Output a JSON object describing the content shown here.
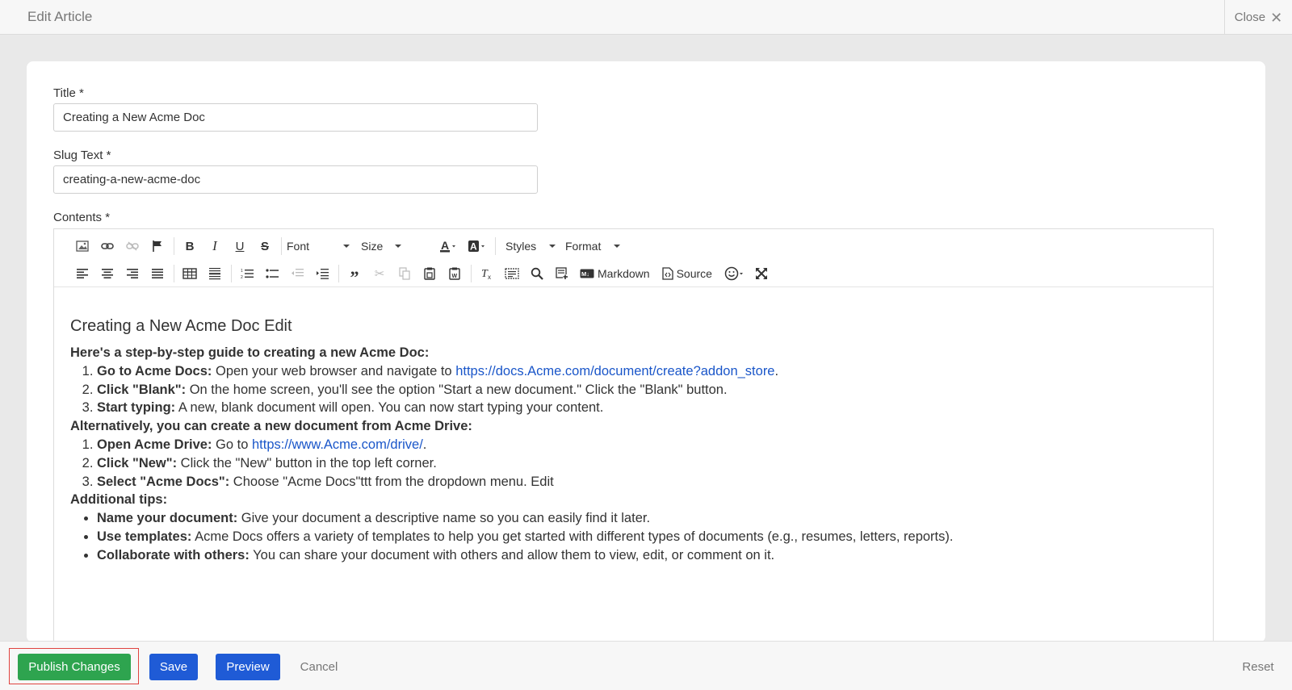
{
  "header": {
    "title": "Edit Article",
    "close_label": "Close"
  },
  "form": {
    "title_label": "Title *",
    "title_value": "Creating a New Acme Doc",
    "slug_label": "Slug Text *",
    "slug_value": "creating-a-new-acme-doc",
    "contents_label": "Contents *"
  },
  "toolbar": {
    "font_label": "Font",
    "size_label": "Size",
    "styles_label": "Styles",
    "format_label": "Format",
    "markdown_label": "Markdown",
    "source_label": "Source"
  },
  "content": {
    "heading": "Creating a New Acme Doc Edit",
    "intro": "Here's a step-by-step guide to creating a new Acme Doc:",
    "steps1": [
      {
        "bold": "Go to Acme Docs:",
        "text": " Open your web browser and navigate to ",
        "link": "https://docs.Acme.com/document/create?addon_store",
        "after": "."
      },
      {
        "bold": "Click \"Blank\":",
        "text": " On the home screen, you'll see the option \"Start a new document.\" Click the \"Blank\" button."
      },
      {
        "bold": "Start typing:",
        "text": " A new, blank document will open. You can now start typing your content."
      }
    ],
    "alt_intro": "Alternatively, you can create a new document from Acme Drive:",
    "steps2": [
      {
        "bold": "Open Acme Drive:",
        "text": " Go to ",
        "link": "https://www.Acme.com/drive/",
        "after": "."
      },
      {
        "bold": "Click \"New\":",
        "text": " Click the \"New\" button in the top left corner."
      },
      {
        "bold": "Select \"Acme Docs\":",
        "text": " Choose \"Acme Docs\"ttt from the dropdown menu. Edit"
      }
    ],
    "tips_intro": "Additional tips:",
    "tips": [
      {
        "bold": "Name your document:",
        "text": " Give your document a descriptive name so you can easily find it later."
      },
      {
        "bold": "Use templates:",
        "text": " Acme Docs offers a variety of templates to help you get started with different types of documents (e.g., resumes, letters, reports)."
      },
      {
        "bold": "Collaborate with others:",
        "text": " You can share your document with others and allow them to view, edit, or comment on it."
      }
    ]
  },
  "footer": {
    "publish_label": "Publish Changes",
    "save_label": "Save",
    "preview_label": "Preview",
    "cancel_label": "Cancel",
    "reset_label": "Reset"
  },
  "colors": {
    "publish": "#2ea44f",
    "primary": "#1f5bd6",
    "link": "#1a56c9",
    "highlight": "#e0433f"
  }
}
